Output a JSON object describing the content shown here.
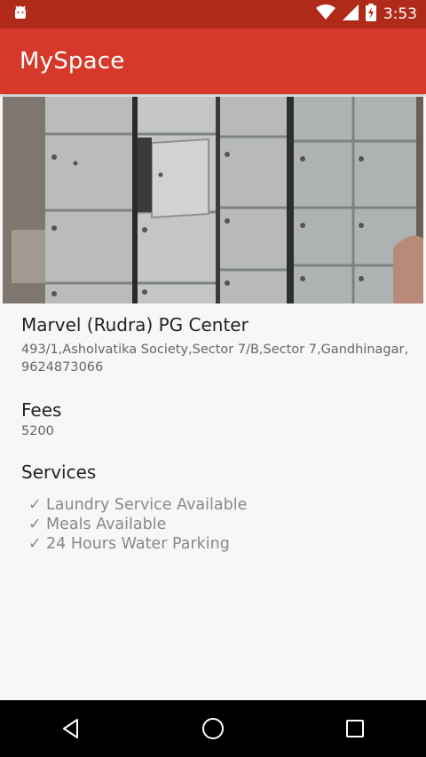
{
  "status_bar": {
    "time": "3:53",
    "icons": [
      "android-debug-icon",
      "wifi-icon",
      "cell-signal-icon",
      "battery-charging-icon"
    ]
  },
  "app_bar": {
    "title": "MySpace"
  },
  "listing": {
    "photo": "locker-room-photo",
    "name": "Marvel (Rudra) PG Center",
    "address": "493/1,Asholvatika Society,Sector 7/B,Sector 7,Gandhinagar,",
    "phone": "9624873066",
    "fees_heading": "Fees",
    "fees_value": "5200",
    "services_heading": "Services",
    "services": [
      "Laundry Service Available",
      "Meals Available",
      "24 Hours Water Parking"
    ],
    "check_glyph": "✓"
  },
  "nav_bar": {
    "icons": [
      "back-icon",
      "home-icon",
      "recents-icon"
    ]
  },
  "colors": {
    "status_bar": "#b02a19",
    "app_bar": "#d6392a",
    "background": "#f6f7f9"
  }
}
